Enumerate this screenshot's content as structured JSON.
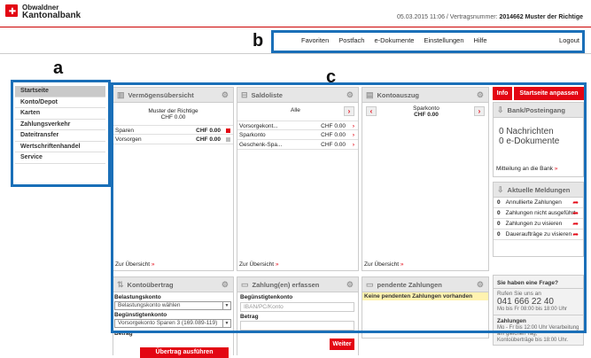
{
  "bank": {
    "name_line1": "Obwaldner",
    "name_line2": "Kantonalbank"
  },
  "top_info": {
    "datetime_contract": "05.03.2015 11:06 / Vertragsnummer:",
    "contract_owner": "2014662 Muster der Richtige"
  },
  "nav": {
    "items": [
      "Favoriten",
      "Postfach",
      "e-Dokumente",
      "Einstellungen",
      "Hilfe"
    ],
    "logout": "Logout"
  },
  "annotations": {
    "a": "a",
    "b": "b",
    "c": "c"
  },
  "sidebar": {
    "items": [
      "Startseite",
      "Konto/Depot",
      "Karten",
      "Zahlungsverkehr",
      "Dateitransfer",
      "Wertschriftenhandel",
      "Service"
    ]
  },
  "verm": {
    "title": "Vermögensübersicht",
    "owner": "Muster der Richtige",
    "total": "CHF 0.00",
    "rows": [
      {
        "label": "Sparen",
        "value": "CHF 0.00"
      },
      {
        "label": "Vorsorgen",
        "value": "CHF 0.00"
      }
    ],
    "link": "Zur Übersicht",
    "link_arrow": "»"
  },
  "saldo": {
    "title": "Saldoliste",
    "filter": "Alle",
    "rows": [
      {
        "label": "Vorsorgekont...",
        "value": "CHF 0.00"
      },
      {
        "label": "Sparkonto",
        "value": "CHF 0.00"
      },
      {
        "label": "Geschenk-Spa...",
        "value": "CHF 0.00"
      }
    ],
    "link": "Zur Übersicht",
    "link_arrow": "»",
    "arrow": "›"
  },
  "konto": {
    "title": "Kontoauszug",
    "account": "Sparkonto",
    "amount": "CHF 0.00",
    "link": "Zur Übersicht",
    "link_arrow": "»",
    "prev": "‹",
    "next": "›"
  },
  "right": {
    "info_btn": "Info",
    "customize_btn": "Startseite anpassen",
    "post": {
      "title": "Bank/Posteingang",
      "msgs": "0 Nachrichten",
      "docs": "0 e-Dokumente",
      "link": "Mitteilung an die Bank",
      "link_arrow": "»"
    },
    "meld": {
      "title": "Aktuelle Meldungen",
      "items": [
        {
          "n": "0",
          "label": "Annullierte Zahlungen"
        },
        {
          "n": "0",
          "label": "Zahlungen nicht ausgeführt"
        },
        {
          "n": "0",
          "label": "Zahlungen zu visieren"
        },
        {
          "n": "0",
          "label": "Daueraufträge zu visieren"
        }
      ]
    },
    "help": {
      "title": "Sie haben eine Frage?",
      "call": "Rufen Sie uns an",
      "phone": "041 666 22 40",
      "hours": "Mo bis Fr 08:00 bis 18:00 Uhr"
    },
    "zahl": {
      "title": "Zahlungen",
      "line1": "Mo - Fr bis 12:00 Uhr Verarbeitung",
      "line2": "am gleichen Tag,",
      "line3": "Kontoüberträge bis 18:00 Uhr."
    }
  },
  "ueber": {
    "title": "Kontoübertrag",
    "label1": "Belastungskonto",
    "select1": "Belastungskonto wählen",
    "label2": "Begünstigtenkonto",
    "select2": "Vorsorgekonto Sparen 3 (169.089-119)",
    "label3": "Betrag",
    "btn": "Übertrag ausführen"
  },
  "erf": {
    "title": "Zahlung(en) erfassen",
    "label1": "Begünstigtenkonto",
    "placeholder": "IBAN/PC/Konto",
    "label2": "Betrag",
    "btn": "Weiter"
  },
  "pend": {
    "title": "pendente Zahlungen",
    "msg": "Keine pendenten Zahlungen vorhanden"
  },
  "colors": {
    "accent": "#e30613",
    "annotation": "#1a6fb8"
  }
}
